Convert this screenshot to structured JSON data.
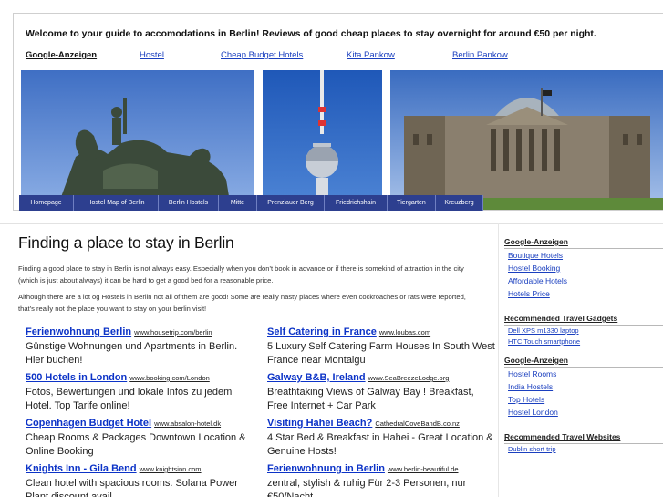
{
  "header": {
    "welcome": "Welcome to your guide to accomodations in Berlin! Reviews of good cheap places to stay overnight for around €50 per night.",
    "ads_label": "Google-Anzeigen",
    "top_links": [
      "Hostel",
      "Cheap Budget Hotels",
      "Kita Pankow",
      "Berlin Pankow"
    ]
  },
  "nav": {
    "items": [
      "Homepage",
      "Hostel Map of Berlin",
      "Berlin Hostels",
      "Mitte",
      "Prenzlauer Berg",
      "Friedrichshain",
      "Tiergarten",
      "Kreuzberg"
    ]
  },
  "main": {
    "title": "Finding a place to stay in Berlin",
    "intro_1": "Finding a good place to stay in Berlin is not always easy. Especially when you don't book in advance or if there is somekind of attraction in the city (which is just about always) it can be hard to get a good bed for a reasonable price.",
    "intro_2": "Although there are a lot og Hostels in Berlin not all of them are good! Some are really nasty places where even cockroaches or rats were reported, that's really not the place you want to stay on your berlin visit!",
    "ads": [
      {
        "title": "Ferienwohnung Berlin",
        "url": "www.housetrip.com/berlin",
        "desc": "Günstige Wohnungen und Apartments in Berlin. Hier buchen!"
      },
      {
        "title": "Self Catering in France",
        "url": "www.loubas.com",
        "desc": "5 Luxury Self Catering Farm Houses In South West France near Montaigu"
      },
      {
        "title": "500 Hotels in London",
        "url": "www.booking.com/London",
        "desc": "Fotos, Bewertungen und lokale Infos zu jedem Hotel. Top Tarife online!"
      },
      {
        "title": "Galway B&B, Ireland",
        "url": "www.SeaBreezeLodge.org",
        "desc": "Breathtaking Views of Galway Bay ! Breakfast, Free Internet + Car Park"
      },
      {
        "title": "Copenhagen Budget Hotel",
        "url": "www.absalon-hotel.dk",
        "desc": "Cheap Rooms & Packages Downtown Location & Online Booking"
      },
      {
        "title": "Visiting Hahei Beach?",
        "url": "CathedralCoveBandB.co.nz",
        "desc": "4 Star Bed & Breakfast in Hahei - Great Location & Genuine Hosts!"
      },
      {
        "title": "Knights Inn - Gila Bend",
        "url": "www.knightsinn.com",
        "desc": "Clean hotel with spacious rooms. Solana Power Plant discount avail."
      },
      {
        "title": "Ferienwohnung in Berlin",
        "url": "www.berlin-beautiful.de",
        "desc": "zentral, stylish & ruhig Für 2-3 Personen, nur €50/Nacht"
      }
    ]
  },
  "sidebar": {
    "ads_heading": "Google-Anzeigen",
    "ads_1": [
      "Boutique Hotels",
      "Hostel Booking",
      "Affordable Hotels",
      "Hotels Price"
    ],
    "gadgets_heading": "Recommended Travel Gadgets",
    "gadgets": [
      "Dell XPS m1330 laptop",
      "HTC Touch smartphone"
    ],
    "ads_heading_2": "Google-Anzeigen",
    "ads_2": [
      "Hostel Rooms",
      "India Hostels",
      "Top Hotels",
      "Hostel London"
    ],
    "websites_heading": "Recommended Travel Websites",
    "websites": [
      "Dublin short trip"
    ]
  },
  "colors": {
    "nav_bg": "#2d3f8f",
    "link": "#1a3fbf",
    "ad_title": "#0c33c7",
    "sky": "#4d79c6"
  }
}
